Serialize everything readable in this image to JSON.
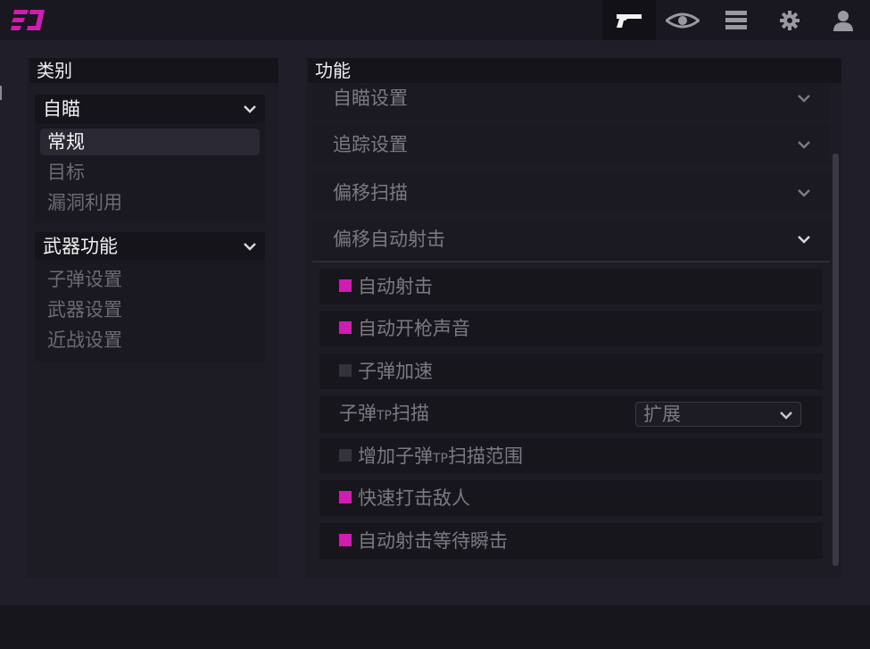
{
  "topbar": {
    "icons": [
      "pistol-icon",
      "eye-icon",
      "menu-list-icon",
      "gear-icon",
      "user-icon"
    ],
    "accent_color": "#d11cb0"
  },
  "categories": {
    "title": "类别",
    "groups": [
      {
        "label": "自瞄",
        "items": [
          "常规",
          "目标",
          "漏洞利用"
        ],
        "selected": "常规"
      },
      {
        "label": "武器功能",
        "items": [
          "子弹设置",
          "武器设置",
          "近战设置"
        ]
      }
    ]
  },
  "features": {
    "title": "功能",
    "sections": [
      "自瞄设置",
      "追踪设置",
      "偏移扫描",
      "偏移自动射击"
    ],
    "options": [
      {
        "label": "自动射击",
        "checked": true
      },
      {
        "label": "自动开枪声音",
        "checked": true
      },
      {
        "label": "子弹加速",
        "checked": false
      },
      {
        "label_a": "子弹",
        "label_tp": "TP",
        "label_b": "扫描",
        "select_value": "扩展"
      },
      {
        "label_a": "增加子弹",
        "label_tp": "TP",
        "label_b": "扫描范围",
        "checked": false
      },
      {
        "label": "快速打击敌人",
        "checked": true
      },
      {
        "label": "自动射击等待瞬击",
        "checked": true
      }
    ]
  }
}
